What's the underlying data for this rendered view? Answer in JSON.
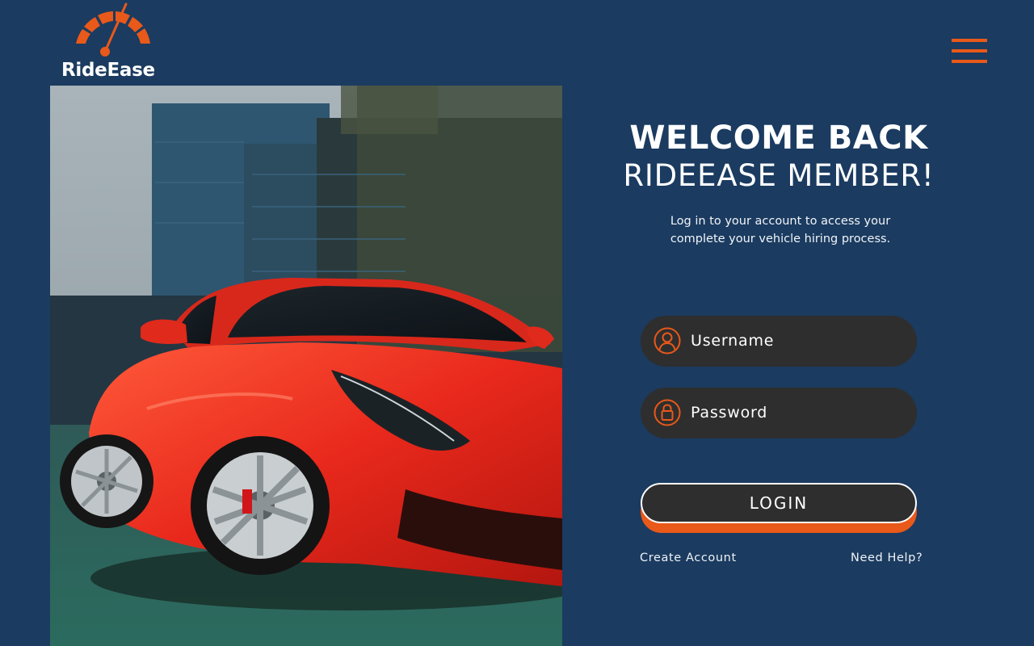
{
  "brand": {
    "name": "RideEase",
    "logo_icon": "speedometer-icon",
    "accent_color": "#e8591a",
    "background_color": "#1b3b60",
    "field_color": "#2e2e2e"
  },
  "header": {
    "menu_icon": "hamburger-menu-icon"
  },
  "hero": {
    "image_subject": "red sports car in front of buildings"
  },
  "login": {
    "title_line1": "WELCOME BACK",
    "title_line2": "RIDEEASE MEMBER!",
    "subtitle_line1": "Log in to your account to access your",
    "subtitle_line2": "complete your vehicle hiring process.",
    "username": {
      "placeholder": "Username",
      "value": "",
      "icon": "user-icon"
    },
    "password": {
      "placeholder": "Password",
      "value": "",
      "icon": "lock-icon"
    },
    "submit_label": "LOGIN",
    "create_account_label": "Create Account",
    "need_help_label": "Need Help?"
  }
}
